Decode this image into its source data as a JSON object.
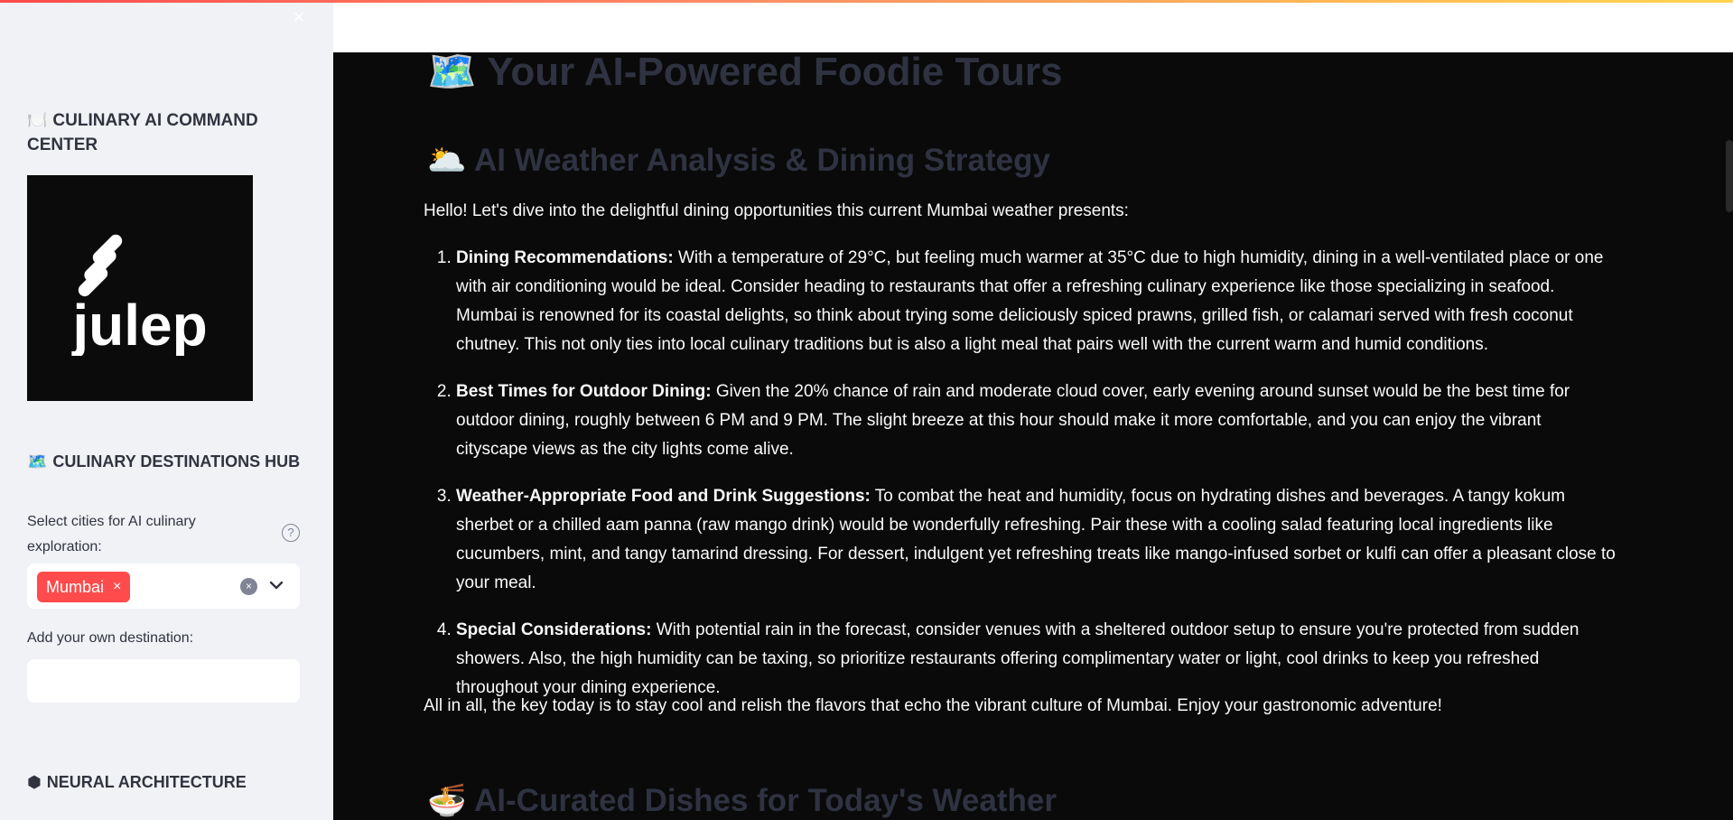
{
  "sidebar": {
    "close_label": "×",
    "command_center": {
      "emoji": "🍽️",
      "title": "CULINARY AI COMMAND CENTER"
    },
    "logo_text": "julep",
    "destinations_hub": {
      "emoji": "🗺️",
      "title": "CULINARY DESTINATIONS HUB"
    },
    "select_label": "Select cities for AI culinary exploration:",
    "help_icon": "?",
    "selected_city": "Mumbai",
    "remove_tag": "×",
    "clear_icon": "×",
    "add_label": "Add your own destination:",
    "add_value": "",
    "neural": {
      "emoji": "⬢",
      "title": "NEURAL ARCHITECTURE"
    }
  },
  "main": {
    "title_emoji": "🗺️",
    "title": "Your AI-Powered Foodie Tours",
    "weather_emoji": "🌥️",
    "weather_heading": "AI Weather Analysis & Dining Strategy",
    "intro": "Hello! Let's dive into the delightful dining opportunities this current Mumbai weather presents:",
    "items": [
      {
        "label": "Dining Recommendations:",
        "text": " With a temperature of 29°C, but feeling much warmer at 35°C due to high humidity, dining in a well-ventilated place or one with air conditioning would be ideal. Consider heading to restaurants that offer a refreshing culinary experience like those specializing in seafood. Mumbai is renowned for its coastal delights, so think about trying some deliciously spiced prawns, grilled fish, or calamari served with fresh coconut chutney. This not only ties into local culinary traditions but is also a light meal that pairs well with the current warm and humid conditions."
      },
      {
        "label": "Best Times for Outdoor Dining:",
        "text": " Given the 20% chance of rain and moderate cloud cover, early evening around sunset would be the best time for outdoor dining, roughly between 6 PM and 9 PM. The slight breeze at this hour should make it more comfortable, and you can enjoy the vibrant cityscape views as the city lights come alive."
      },
      {
        "label": "Weather-Appropriate Food and Drink Suggestions:",
        "text": " To combat the heat and humidity, focus on hydrating dishes and beverages. A tangy kokum sherbet or a chilled aam panna (raw mango drink) would be wonderfully refreshing. Pair these with a cooling salad featuring local ingredients like cucumbers, mint, and tangy tamarind dressing. For dessert, indulgent yet refreshing treats like mango-infused sorbet or kulfi can offer a pleasant close to your meal."
      },
      {
        "label": "Special Considerations:",
        "text": " With potential rain in the forecast, consider venues with a sheltered outdoor setup to ensure you're protected from sudden showers. Also, the high humidity can be taxing, so prioritize restaurants offering complimentary water or light, cool drinks to keep you refreshed throughout your dining experience."
      }
    ],
    "outro": "All in all, the key today is to stay cool and relish the flavors that echo the vibrant culture of Mumbai. Enjoy your gastronomic adventure!",
    "dishes_emoji": "🍜",
    "dishes_heading": "AI-Curated Dishes for Today's Weather"
  },
  "colors": {
    "accent": "#ff4b4b",
    "sidebar_bg": "#f0f2f6",
    "main_bg": "#0a0a0a",
    "heading_dim": "#2f3240"
  }
}
